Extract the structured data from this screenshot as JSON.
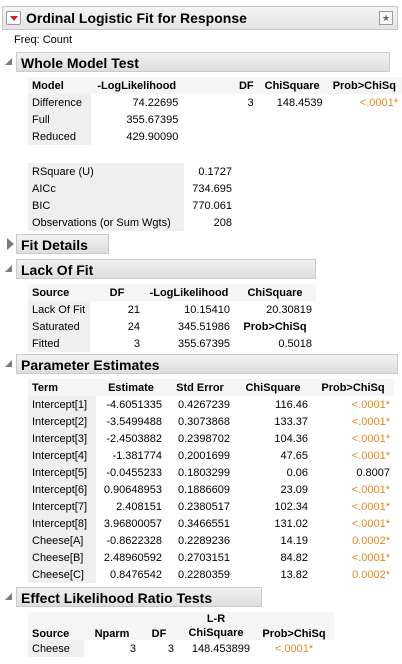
{
  "report": {
    "title": "Ordinal Logistic Fit for Response",
    "freq": "Freq: Count"
  },
  "sig_color": "#e08a1e",
  "sections": {
    "whole_model": "Whole Model Test",
    "fit_details": "Fit Details",
    "lack_of_fit": "Lack Of Fit",
    "param_est": "Parameter Estimates",
    "effect_lr": "Effect Likelihood Ratio Tests"
  },
  "whole_model": {
    "headers": [
      "Model",
      "-LogLikelihood",
      "DF",
      "ChiSquare",
      "Prob>ChiSq"
    ],
    "rows": [
      [
        "Difference",
        "74.22695",
        "3",
        "148.4539",
        "<.0001*"
      ],
      [
        "Full",
        "355.67395",
        "",
        "",
        ""
      ],
      [
        "Reduced",
        "429.90090",
        "",
        "",
        ""
      ]
    ],
    "stats": [
      [
        "RSquare (U)",
        "0.1727"
      ],
      [
        "AICc",
        "734.695"
      ],
      [
        "BIC",
        "770.061"
      ],
      [
        "Observations (or Sum Wgts)",
        "208"
      ]
    ]
  },
  "lack_of_fit": {
    "headers": [
      "Source",
      "DF",
      "-LogLikelihood",
      "ChiSquare"
    ],
    "rows": [
      [
        "Lack Of Fit",
        "21",
        "10.15410",
        "20.30819"
      ],
      [
        "Saturated",
        "24",
        "345.51986",
        "Prob>ChiSq"
      ],
      [
        "Fitted",
        "3",
        "355.67395",
        "0.5018"
      ]
    ]
  },
  "param_est": {
    "headers": [
      "Term",
      "Estimate",
      "Std Error",
      "ChiSquare",
      "Prob>ChiSq"
    ],
    "rows": [
      [
        "Intercept[1]",
        "-4.6051335",
        "0.4267239",
        "116.46",
        "<.0001*"
      ],
      [
        "Intercept[2]",
        "-3.5499488",
        "0.3073868",
        "133.37",
        "<.0001*"
      ],
      [
        "Intercept[3]",
        "-2.4503882",
        "0.2398702",
        "104.36",
        "<.0001*"
      ],
      [
        "Intercept[4]",
        "-1.381774",
        "0.2001699",
        "47.65",
        "<.0001*"
      ],
      [
        "Intercept[5]",
        "-0.0455233",
        "0.1803299",
        "0.06",
        "0.8007"
      ],
      [
        "Intercept[6]",
        "0.90648953",
        "0.1886609",
        "23.09",
        "<.0001*"
      ],
      [
        "Intercept[7]",
        "2.408151",
        "0.2380517",
        "102.34",
        "<.0001*"
      ],
      [
        "Intercept[8]",
        "3.96800057",
        "0.3466551",
        "131.02",
        "<.0001*"
      ],
      [
        "Cheese[A]",
        "-0.8622328",
        "0.2289236",
        "14.19",
        "0.0002*"
      ],
      [
        "Cheese[B]",
        "2.48960592",
        "0.2703151",
        "84.82",
        "<.0001*"
      ],
      [
        "Cheese[C]",
        "0.8476542",
        "0.2280359",
        "13.82",
        "0.0002*"
      ]
    ]
  },
  "effect_lr": {
    "headers": [
      "Source",
      "Nparm",
      "DF",
      "L-R",
      "ChiSquare",
      "Prob>ChiSq"
    ],
    "rows": [
      [
        "Cheese",
        "3",
        "3",
        "148.453899",
        "<.0001*"
      ]
    ]
  }
}
